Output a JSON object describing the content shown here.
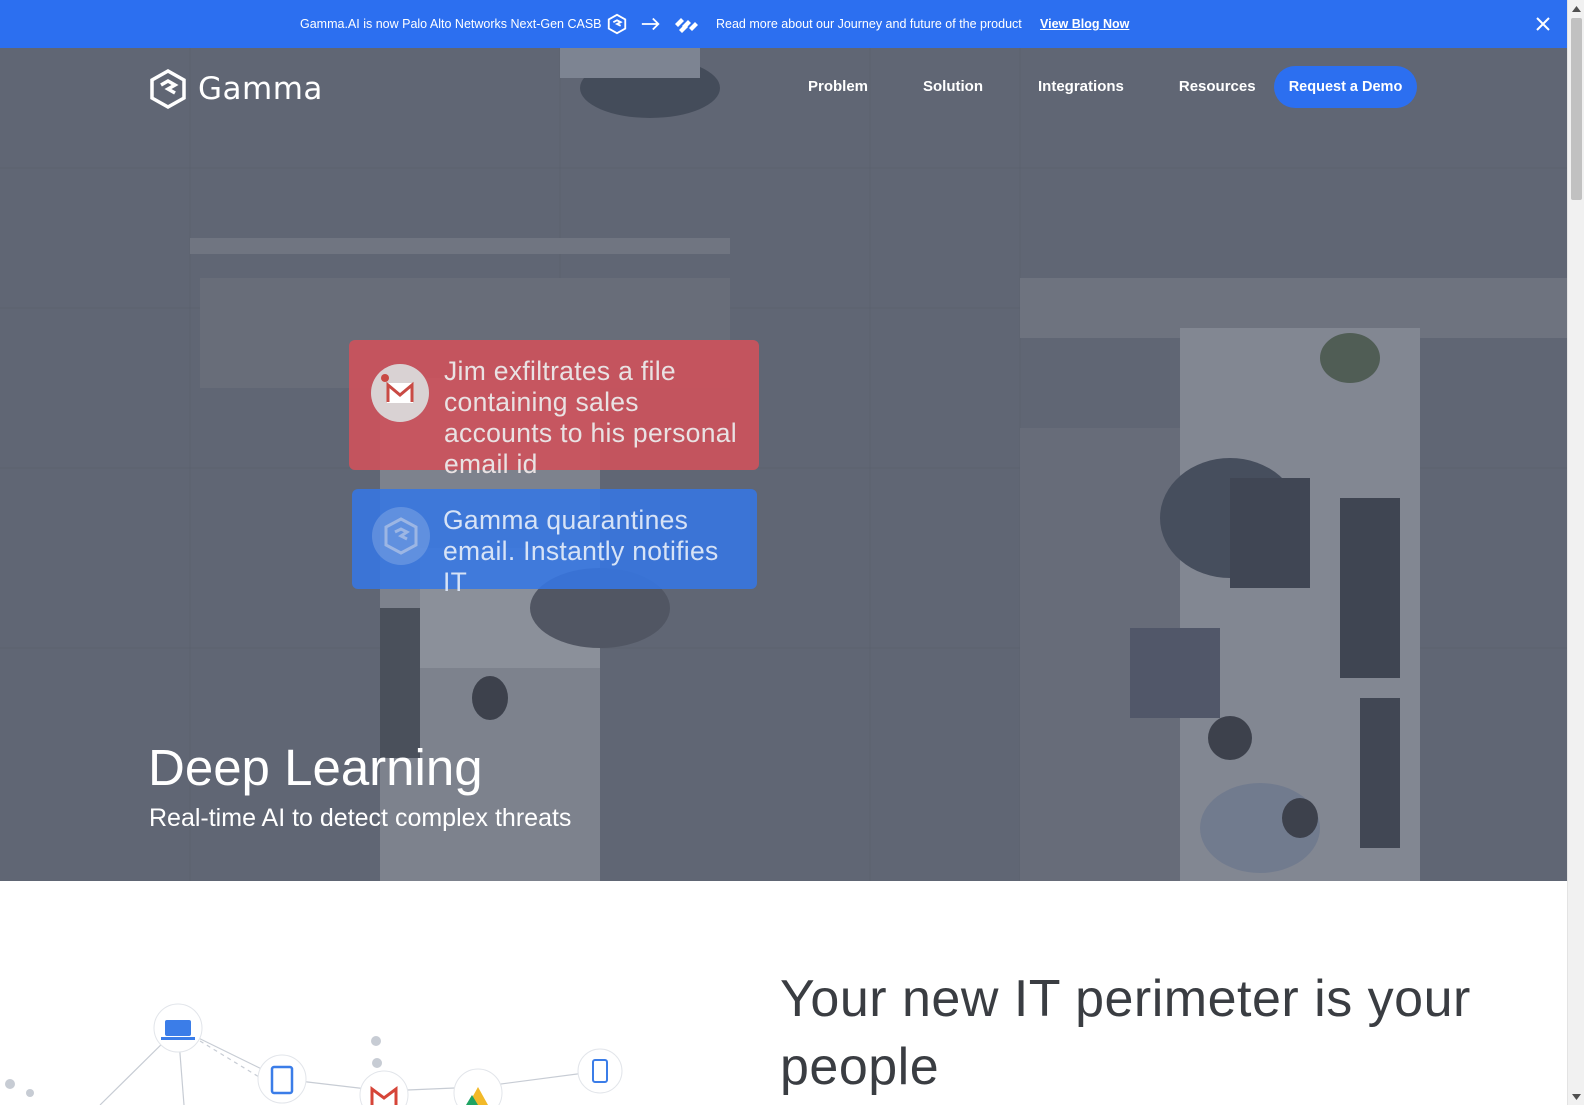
{
  "banner": {
    "announcement": "Gamma.AI is now Palo Alto Networks Next-Gen CASB",
    "read_more": "Read more about our Journey and future of the product",
    "link_label": "View Blog Now"
  },
  "nav": {
    "logo_text": "Gamma",
    "links": [
      "Problem",
      "Solution",
      "Integrations",
      "Resources"
    ],
    "cta": "Request a Demo"
  },
  "hero": {
    "alert_card": "Jim exfiltrates a file containing sales accounts to his personal email id",
    "quarantine_card": "Gamma quarantines email. Instantly notifies IT",
    "title": "Deep Learning",
    "subtitle": "Real-time AI to detect complex threats"
  },
  "section2": {
    "heading": "Your new IT perimeter is your people"
  },
  "colors": {
    "brand_blue": "#2c6ff0",
    "alert_red": "#cc525c"
  }
}
